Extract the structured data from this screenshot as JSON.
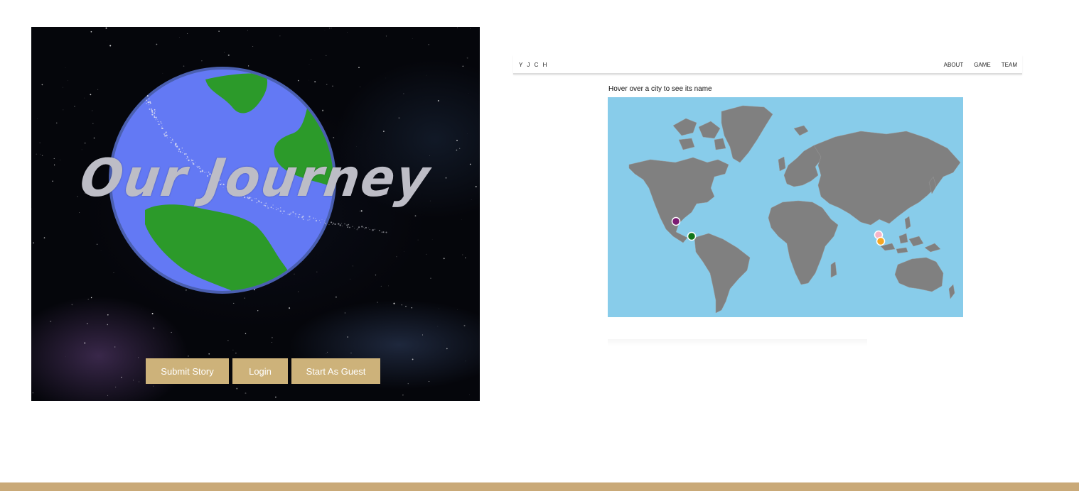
{
  "game_screen": {
    "title": "Our Journey",
    "buttons": {
      "submit_story": "Submit Story",
      "login": "Login",
      "start_as_guest": "Start As Guest"
    },
    "colors": {
      "button": "#cdb27a",
      "ocean": "#6379f4",
      "land": "#2c9a2a",
      "title": "#bdbdc6"
    }
  },
  "map_page": {
    "brand": "Y J C H",
    "nav": {
      "about": "ABOUT",
      "game": "GAME",
      "team": "TEAM"
    },
    "hint": "Hover over a city to see its name",
    "city_markers": [
      {
        "color": "#7b1b73"
      },
      {
        "color": "#11751a"
      },
      {
        "color": "#f6b4c8"
      },
      {
        "color": "#f5a623"
      }
    ],
    "colors": {
      "sea": "#88ccea",
      "land": "#808080"
    }
  },
  "footer": {
    "color": "#c9a978"
  }
}
